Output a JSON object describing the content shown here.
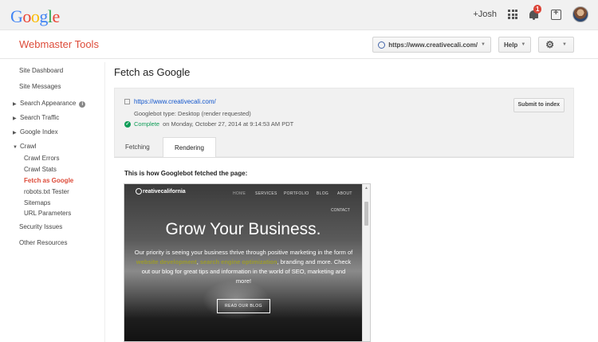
{
  "top_bar": {
    "logo_letters": [
      {
        "char": "G",
        "color": "#4285f4"
      },
      {
        "char": "o",
        "color": "#ea4335"
      },
      {
        "char": "o",
        "color": "#fbbc05"
      },
      {
        "char": "g",
        "color": "#4285f4"
      },
      {
        "char": "l",
        "color": "#34a853"
      },
      {
        "char": "e",
        "color": "#ea4335"
      }
    ],
    "user_link": "+Josh",
    "notification_count": "1"
  },
  "app": {
    "title": "Webmaster Tools",
    "site_selector": "https://www.creativecali.com/",
    "help_label": "Help"
  },
  "sidebar": {
    "items": [
      {
        "label": "Site Dashboard"
      },
      {
        "label": "Site Messages"
      },
      {
        "label": "Search Appearance"
      },
      {
        "label": "Search Traffic"
      },
      {
        "label": "Google Index"
      },
      {
        "label": "Crawl"
      },
      {
        "label": "Crawl Errors"
      },
      {
        "label": "Crawl Stats"
      },
      {
        "label": "Fetch as Google"
      },
      {
        "label": "robots.txt Tester"
      },
      {
        "label": "Sitemaps"
      },
      {
        "label": "URL Parameters"
      },
      {
        "label": "Security Issues"
      },
      {
        "label": "Other Resources"
      }
    ]
  },
  "main": {
    "title": "Fetch as Google",
    "fetch_url": "https://www.creativecali.com/",
    "googlebot_type": "Googlebot type: Desktop (render requested)",
    "status": "Complete",
    "status_detail": "on Monday, October 27, 2014 at 9:14:53 AM PDT",
    "submit_label": "Submit to index",
    "tabs": [
      {
        "label": "Fetching"
      },
      {
        "label": "Rendering"
      }
    ],
    "caption": "This is how Googlebot fetched the page:"
  },
  "rendered_page": {
    "logo_text": "reativecalifornia",
    "nav": [
      "HOME",
      "SERVICES",
      "PORTFOLIO",
      "BLOG",
      "ABOUT"
    ],
    "contact": "CONTACT",
    "hero": "Grow Your Business.",
    "body_1": "Our priority is seeing your business thrive through positive marketing in the form of ",
    "link_1": "website development",
    "body_2": ", ",
    "link_2": "search engine optimization",
    "body_3": ", branding and more. Check out our blog for great tips and information in the world of SEO, marketing and more!",
    "button": "READ OUR BLOG"
  }
}
